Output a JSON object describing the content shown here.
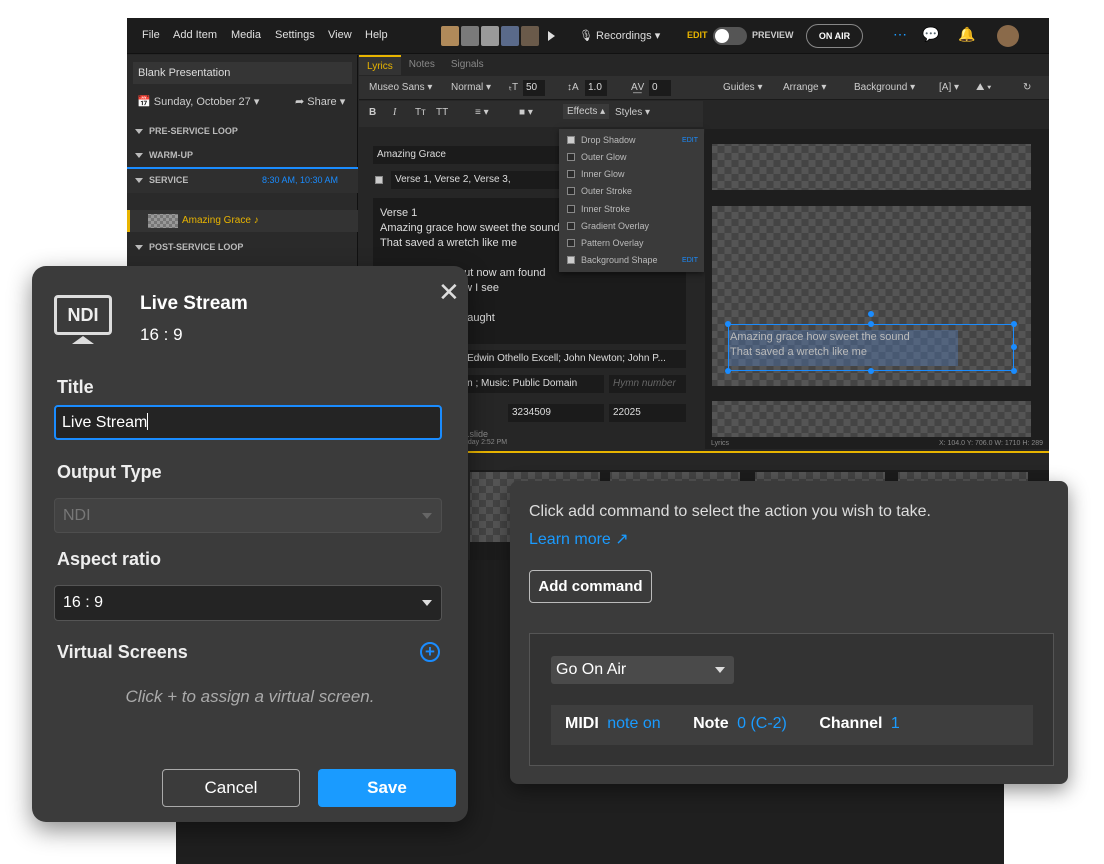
{
  "menu": [
    "File",
    "Add Item",
    "Media",
    "Settings",
    "View",
    "Help"
  ],
  "topbar": {
    "recordings": "Recordings",
    "edit": "EDIT",
    "preview": "PREVIEW",
    "on_air": "ON AIR"
  },
  "sidebar": {
    "presentation_title": "Blank Presentation",
    "date": "Sunday, October 27",
    "share": "Share",
    "sections": [
      {
        "label": "PRE-SERVICE LOOP"
      },
      {
        "label": "WARM-UP"
      },
      {
        "label": "SERVICE",
        "time": "8:30 AM, 10:30 AM"
      },
      {
        "label": "POST-SERVICE LOOP"
      }
    ],
    "selected_item": "Amazing Grace"
  },
  "editor": {
    "tabs": [
      "Lyrics",
      "Notes",
      "Signals"
    ],
    "font": "Museo Sans",
    "weight": "Normal",
    "size": "50",
    "line_height": "1.0",
    "spacing": "0",
    "guides": "Guides",
    "arrange": "Arrange",
    "background": "Background",
    "effects": "Effects",
    "styles": "Styles",
    "song_title": "Amazing Grace",
    "verses": "Verse 1, Verse 2, Verse 3,",
    "lyrics": [
      "Verse 1",
      "Amazing grace how sweet the sound",
      "That saved a wretch like me",
      "",
      "...ut now am found",
      "...w I see",
      "",
      "...taught"
    ],
    "authors": "...y Edwin Othello Excell; John Newton; John P...",
    "copyright": "...ain ; Music: Public Domain",
    "hymn_placeholder": "Hymn number",
    "ccli": "3234509",
    "year": "22025",
    "footer_left": "...slide",
    "footer_time": "...day 2:52 PM",
    "canvas_label": "Lyrics",
    "coords": "X: 104.0  Y: 706.0    W: 1710  H: 289",
    "canvas_text": [
      "Amazing grace how sweet the sound",
      "That saved a wretch like me"
    ]
  },
  "effects_menu": {
    "items": [
      {
        "label": "Drop Shadow",
        "checked": true,
        "edit": "EDIT"
      },
      {
        "label": "Outer Glow",
        "checked": false
      },
      {
        "label": "Inner Glow",
        "checked": false
      },
      {
        "label": "Outer Stroke",
        "checked": false
      },
      {
        "label": "Inner Stroke",
        "checked": false
      },
      {
        "label": "Gradient Overlay",
        "checked": false
      },
      {
        "label": "Pattern Overlay",
        "checked": false
      },
      {
        "label": "Background Shape",
        "checked": true,
        "edit": "EDIT"
      }
    ]
  },
  "ndi_dialog": {
    "icon_text": "NDI",
    "name": "Live Stream",
    "ratio": "16 : 9",
    "title_label": "Title",
    "title_value": "Live Stream",
    "output_type_label": "Output Type",
    "output_type_value": "NDI",
    "aspect_label": "Aspect ratio",
    "aspect_value": "16 : 9",
    "virtual_screens_label": "Virtual Screens",
    "hint": "Click + to assign a virtual screen.",
    "cancel": "Cancel",
    "save": "Save"
  },
  "command_panel": {
    "info": "Click add command to select the action you wish to take.",
    "learn_more": "Learn more",
    "add_command": "Add command",
    "action": "Go On Air",
    "midi_label": "MIDI",
    "midi_value": "note on",
    "note_label": "Note",
    "note_value": "0 (C-2)",
    "channel_label": "Channel",
    "channel_value": "1"
  },
  "colors": {
    "accent_blue": "#1a9bff",
    "accent_yellow": "#e8b400",
    "dialog_bg": "#3b3b3b"
  }
}
